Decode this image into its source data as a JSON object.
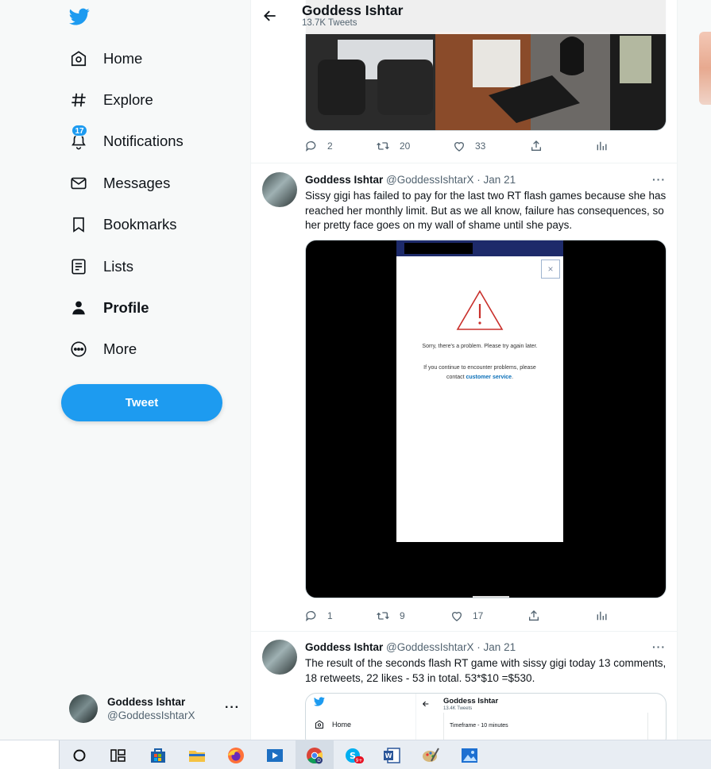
{
  "sidebar": {
    "items": [
      {
        "label": "Home"
      },
      {
        "label": "Explore"
      },
      {
        "label": "Notifications",
        "badge": "17"
      },
      {
        "label": "Messages"
      },
      {
        "label": "Bookmarks"
      },
      {
        "label": "Lists"
      },
      {
        "label": "Profile"
      },
      {
        "label": "More"
      }
    ],
    "tweet_button": "Tweet",
    "account": {
      "name": "Goddess Ishtar",
      "handle": "@GoddessIshtarX",
      "more": "···"
    }
  },
  "header": {
    "title": "Goddess Ishtar",
    "subtitle": "13.7K Tweets"
  },
  "tweets": [
    {
      "replies": "2",
      "retweets": "20",
      "likes": "33"
    },
    {
      "name": "Goddess Ishtar",
      "handle": "@GoddessIshtarX · Jan 21",
      "text": "Sissy gigi has failed to pay for the last two RT flash games because she has reached her monthly limit. But as we all know, failure has consequences, so her pretty face goes on my wall of shame until she pays.",
      "media": {
        "error_line": "Sorry, there's a problem. Please try again later.",
        "help_line1": "If you continue to encounter problems, please",
        "help_line2_prefix": "contact ",
        "help_link": "customer service",
        "help_line2_suffix": ".",
        "close": "×"
      },
      "replies": "1",
      "retweets": "9",
      "likes": "17"
    },
    {
      "name": "Goddess Ishtar",
      "handle": "@GoddessIshtarX · Jan 21",
      "text": "The result of the seconds flash RT game with sissy gigi today 13 comments, 18 retweets, 22 likes - 53 in total. 53*$10 =$530.",
      "media": {
        "nav_home": "Home",
        "title": "Goddess Ishtar",
        "subtitle": "13.4K Tweets",
        "timeframe": "Timeframe - 10 minutes"
      }
    }
  ],
  "colors": {
    "accent": "#1d9bf0",
    "text": "#0f1419",
    "secondary": "#536471"
  }
}
